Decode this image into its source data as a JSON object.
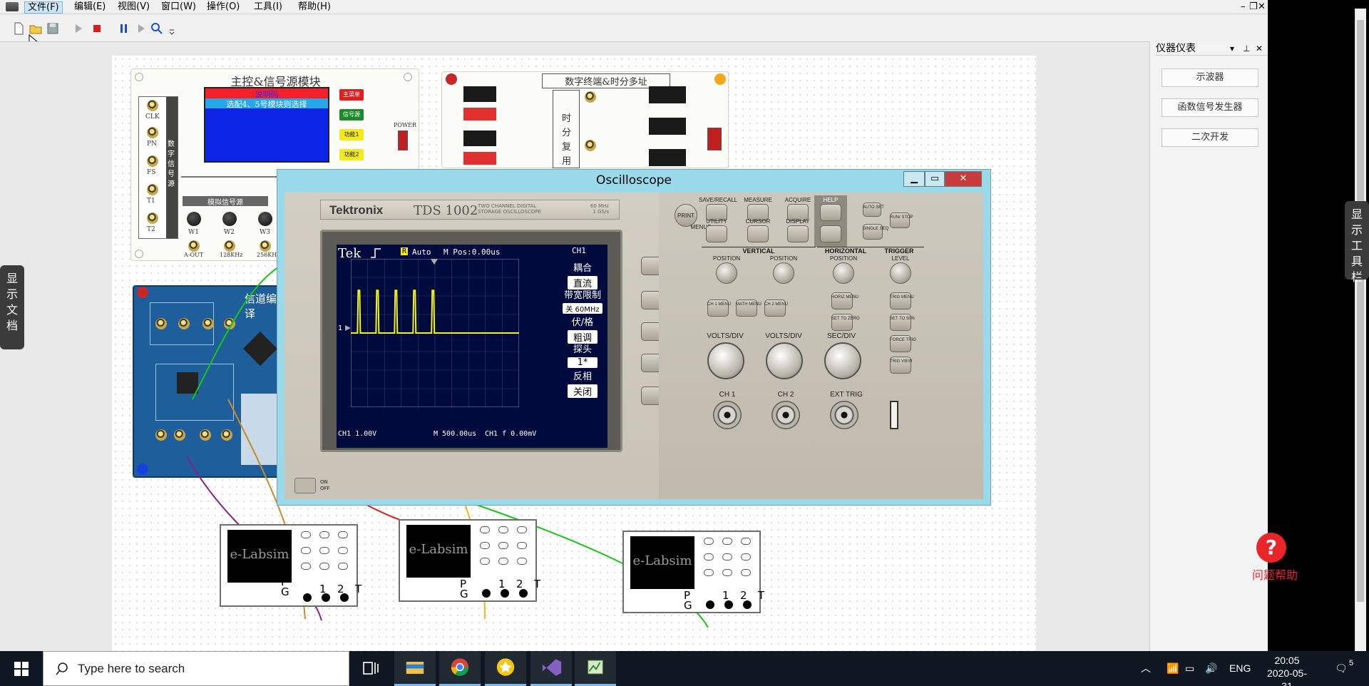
{
  "menubar": {
    "items": [
      "文件(F)",
      "编辑(E)",
      "视图(V)",
      "窗口(W)",
      "操作(O)",
      "工具(I)",
      "帮助(H)"
    ],
    "active_index": 0
  },
  "instruments_panel": {
    "title": "仪器仪表",
    "buttons": [
      "示波器",
      "函数信号发生器",
      "二次开发"
    ]
  },
  "side_tabs": {
    "left": "显示文档",
    "right": "显示工具栏"
  },
  "help": {
    "icon": "?",
    "label": "问题帮助"
  },
  "modules": {
    "main_control": {
      "title": "主控&信号源模块",
      "lcd_line1": "说明码",
      "lcd_line2": "选配4、5号模块则选择",
      "buttons": [
        "主菜单",
        "信号源",
        "功能1",
        "功能2"
      ],
      "power": "POWER",
      "left_jacks": [
        "CLK",
        "PN",
        "FS",
        "T1",
        "T2"
      ],
      "vertical_label": "数字信号源",
      "analog_title": "模拟信号源",
      "knobs": [
        "W1",
        "W2",
        "W3"
      ],
      "outputs": [
        "A-OUT",
        "128KHz",
        "256KHz"
      ]
    },
    "digital_terminal": {
      "title": "数字终端&时分多址",
      "vertical_label": "时分复用"
    },
    "channel_coding": {
      "title": "信道编译"
    },
    "mini_scope": {
      "screen_text": "e-Labsim",
      "labels": [
        "P",
        "G",
        "1",
        "2",
        "T"
      ]
    }
  },
  "oscilloscope": {
    "window_title": "Oscilloscope",
    "brand": "Tektronix",
    "model": "TDS 1002",
    "model_desc": "TWO CHANNEL DIGITAL STORAGE OSCILLOSCOPE",
    "spec_bw": "60 MHz",
    "spec_rate": "1 GS/s",
    "screen": {
      "tek": "Tek",
      "trig_marker": "R",
      "trig_mode": "Auto",
      "m_pos": "M Pos:0.00us",
      "channel": "CH1",
      "ch1_marker": "1",
      "menu": [
        {
          "label": "耦合",
          "value": "直流"
        },
        {
          "label": "带宽限制",
          "value": "关 60MHz"
        },
        {
          "label": "伏/格",
          "value": "粗调"
        },
        {
          "label": "探头",
          "value": "1*"
        },
        {
          "label": "反相",
          "value": "关闭"
        }
      ],
      "bottom_ch1": "CH1  1.00V",
      "bottom_time": "M 500.00us",
      "bottom_trig": "CH1  f 0.00mV"
    },
    "chart_data": {
      "type": "line",
      "title": "",
      "xlabel": "",
      "ylabel": "",
      "description_values": {
        "x": [
          0,
          0.5,
          1.0,
          1.5,
          2.0,
          2.5
        ],
        "pulse_times_divs": [
          0.4,
          1.4,
          2.4,
          3.4,
          4.4
        ],
        "pulse_height_divs": 2.3,
        "baseline_div": 0
      },
      "grid": true
    },
    "buttons": {
      "print": "PRINT",
      "save_recall": "SAVE/RECALL",
      "measure": "MEASURE",
      "acquire": "ACQUIRE",
      "help": "HELP",
      "utility": "UTILITY",
      "cursor": "CURSOR",
      "display": "DISPLAY",
      "default_setup": "DEFAULT SETUP",
      "auto_set": "AUTO SET",
      "run_stop": "RUN/ STOP",
      "single_seq": "SINGLE SEQ",
      "menus": "MENUS",
      "vertical": "VERTICAL",
      "horizontal": "HORIZONTAL",
      "trigger": "TRIGGER",
      "position": "POSITION",
      "level": "LEVEL",
      "ch1_menu": "CH 1 MENU",
      "math_menu": "MATH MENU",
      "ch2_menu": "CH 2 MENU",
      "horiz_menu": "HORIZ MENU",
      "set_to_zero": "SET TO ZERO",
      "trig_menu": "TRIG MENU",
      "set_to_50": "SET TO 50%",
      "force_trig": "FORCE TRIG",
      "trig_view": "TRIG VIEW",
      "volts_div": "VOLTS/DIV",
      "sec_div": "SEC/DIV",
      "ch1": "CH 1",
      "ch2": "CH 2",
      "ext_trig": "EXT TRIG",
      "on": "ON",
      "off": "OFF"
    }
  },
  "taskbar": {
    "search_placeholder": "Type here to search",
    "lang": "ENG",
    "time": "20:05",
    "date": "2020-05-31",
    "notification_count": "5"
  }
}
